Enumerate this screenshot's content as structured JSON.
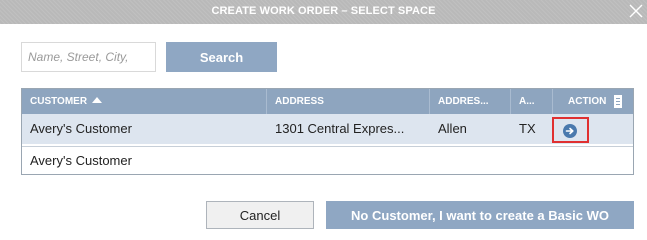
{
  "dialog": {
    "title": "CREATE WORK ORDER – SELECT SPACE",
    "close_icon": "close-icon"
  },
  "search": {
    "placeholder": "Name, Street, City,",
    "value": "",
    "button_label": "Search"
  },
  "grid": {
    "columns": [
      {
        "label": "CUSTOMER",
        "sort": "ascending"
      },
      {
        "label": "ADDRESS"
      },
      {
        "label": "ADDRES..."
      },
      {
        "label": "A..."
      },
      {
        "label": "ACTION"
      }
    ],
    "rows": [
      {
        "customer": "Avery's Customer",
        "address": "1301 Central Expres...",
        "city": "Allen",
        "state": "TX",
        "action_icon": "arrow-right-circle-icon",
        "selected": true
      },
      {
        "customer": "Avery's Customer",
        "address": "",
        "city": "",
        "state": "",
        "action_icon": "",
        "selected": false
      }
    ]
  },
  "footer": {
    "cancel_label": "Cancel",
    "basic_wo_label": "No Customer, I want to create a Basic WO"
  },
  "colors": {
    "header_bg": "#8ea5bf",
    "primary_button": "#8fa7c3",
    "selected_row": "#dde5ef",
    "highlight_box": "#e03030",
    "action_icon": "#4a79ad"
  }
}
